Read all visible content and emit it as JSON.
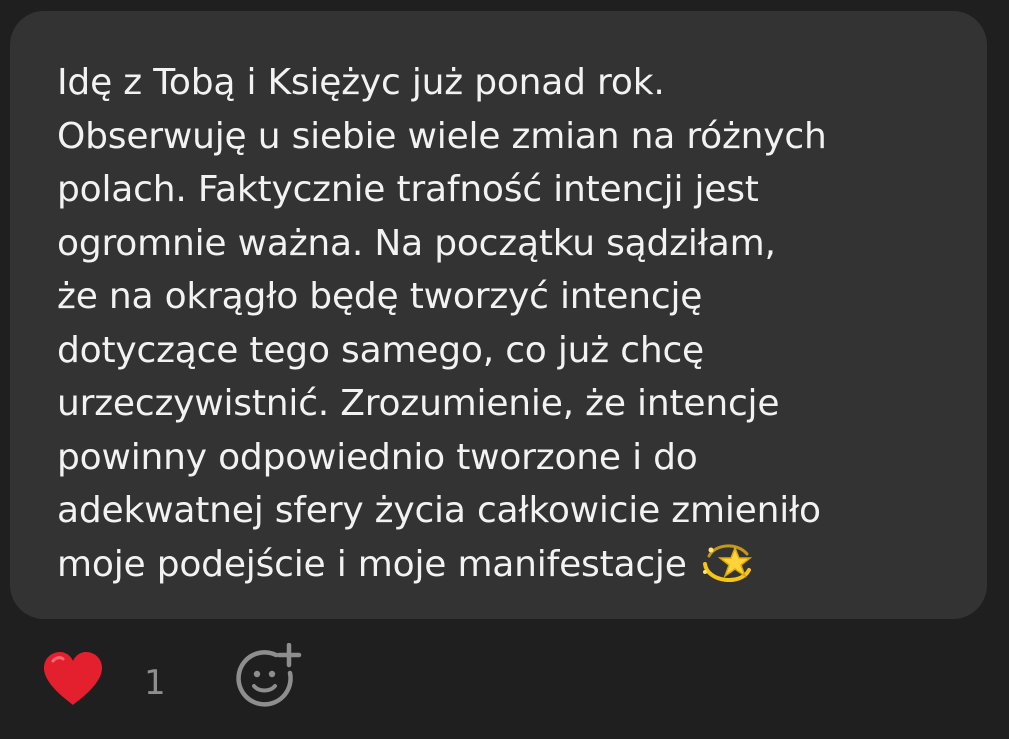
{
  "message": {
    "lines": [
      "Idę z Tobą i Księżyc już ponad rok.",
      "Obserwuję u siebie wiele zmian na różnych",
      "polach. Faktycznie trafność intencji jest",
      "ogromnie ważna. Na początku sądziłam,",
      "że na okrągło będę tworzyć intencję",
      "dotyczące tego samego, co już chcę",
      "urzeczywistnić. Zrozumienie, że intencje",
      "powinny odpowiednio tworzone i do",
      "adekwatnej sfery życia całkowicie zmieniło",
      "moje podejście i moje manifestacje"
    ],
    "trailing_emoji_icon": "dizzy-star-icon"
  },
  "reactions": {
    "heart_icon": "heart-icon",
    "count": "1",
    "add_reaction_icon": "add-reaction-icon"
  },
  "colors": {
    "background": "#1f1f1f",
    "bubble": "#333333",
    "text": "#f2f2f2",
    "muted": "#8e8e8e",
    "heart": "#e5202e",
    "emoji": "#f5c518"
  }
}
